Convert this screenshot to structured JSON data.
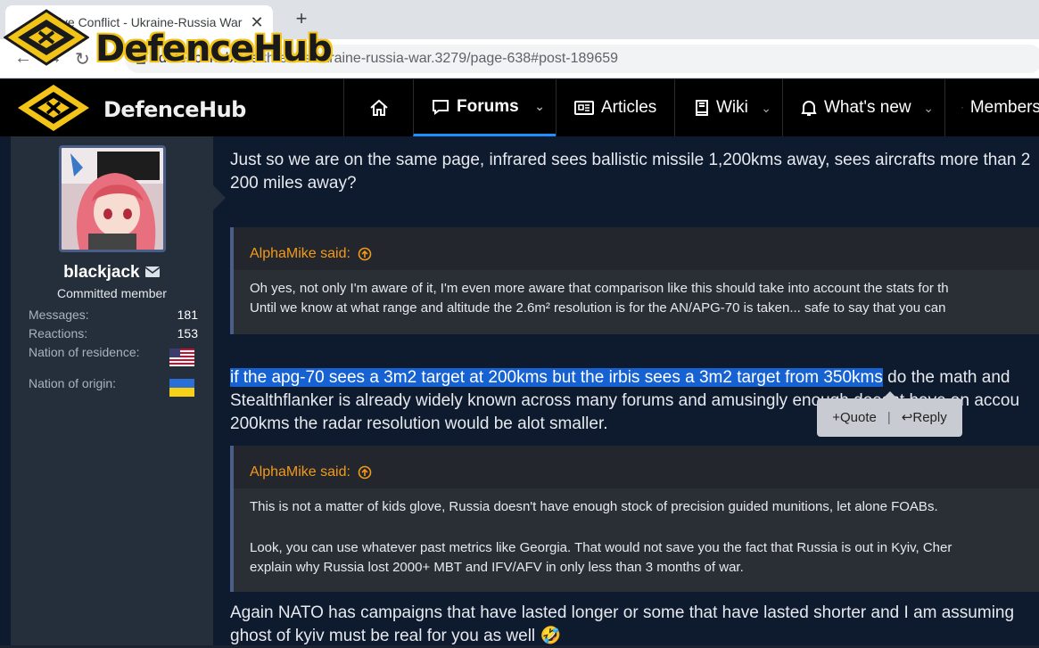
{
  "browser": {
    "tab_title": "Live Conflict - Ukraine-Russia War",
    "tab_close": "✕",
    "new_tab": "+",
    "url_host": "defencehub.live",
    "url_path": "/threads/ukraine-russia-war.3279/page-638#post-189659"
  },
  "watermark": {
    "text": "DefenceHub"
  },
  "site": {
    "logo_text": "DefenceHub",
    "nav": {
      "home_icon": "home-icon",
      "forums": "Forums",
      "articles": "Articles",
      "wiki": "Wiki",
      "whats_new": "What's new",
      "members": "Members"
    }
  },
  "user": {
    "name": "blackjack",
    "title": "Committed member",
    "stats": [
      {
        "label": "Messages:",
        "value": "181"
      },
      {
        "label": "Reactions:",
        "value": "153"
      },
      {
        "label": "Nation of residence:",
        "value": ""
      },
      {
        "label": "Nation of origin:",
        "value": ""
      }
    ]
  },
  "post": {
    "p1_line1": "Just so we are on the same page, infrared sees ballistic missile 1,200kms away, sees aircrafts more than 2",
    "p1_line2": "200 miles away?",
    "quote1": {
      "author": "AlphaMike said:",
      "line1": "Oh yes, not only I'm aware of it, I'm even more aware that comparison like this should take into account the stats for th",
      "line2": "Until we know at what range and altitude the 2.6m² resolution is for the AN/APG-70 is taken... safe to say that you can"
    },
    "p2_highlight": "if the apg-70 sees a 3m2 target at 200kms but the irbis sees a 3m2 target from 350kms",
    "p2_rest": " do the math and",
    "p2_line2": "Stealthflanker is already widely known across many forums and amusingly enough doesnt have an accou",
    "p2_line3": "200kms the radar resolution would be alot smaller.",
    "popup": {
      "quote": "Quote",
      "separator": "|",
      "reply": "Reply"
    },
    "quote2": {
      "author": "AlphaMike said:",
      "line1": "This is not a matter of kids glove, Russia doesn't have enough stock of precision guided munitions, let alone FOABs.",
      "line2": "Look, you can use whatever past metrics like Georgia. That would not save you the fact that Russia is out in Kyiv, Cher",
      "line3": "explain why Russia lost 2000+ MBT and IFV/AFV in only less than 3 months of war."
    },
    "p3_line1": "Again NATO has campaigns that have lasted longer or some that have lasted shorter and I am assuming",
    "p3_line2": "ghost of kyiv must be real for you as well",
    "emoji": "🤣"
  },
  "colors": {
    "accent": "#f39a1a",
    "highlight": "#1762d3",
    "logo_gold": "#f2c418"
  }
}
